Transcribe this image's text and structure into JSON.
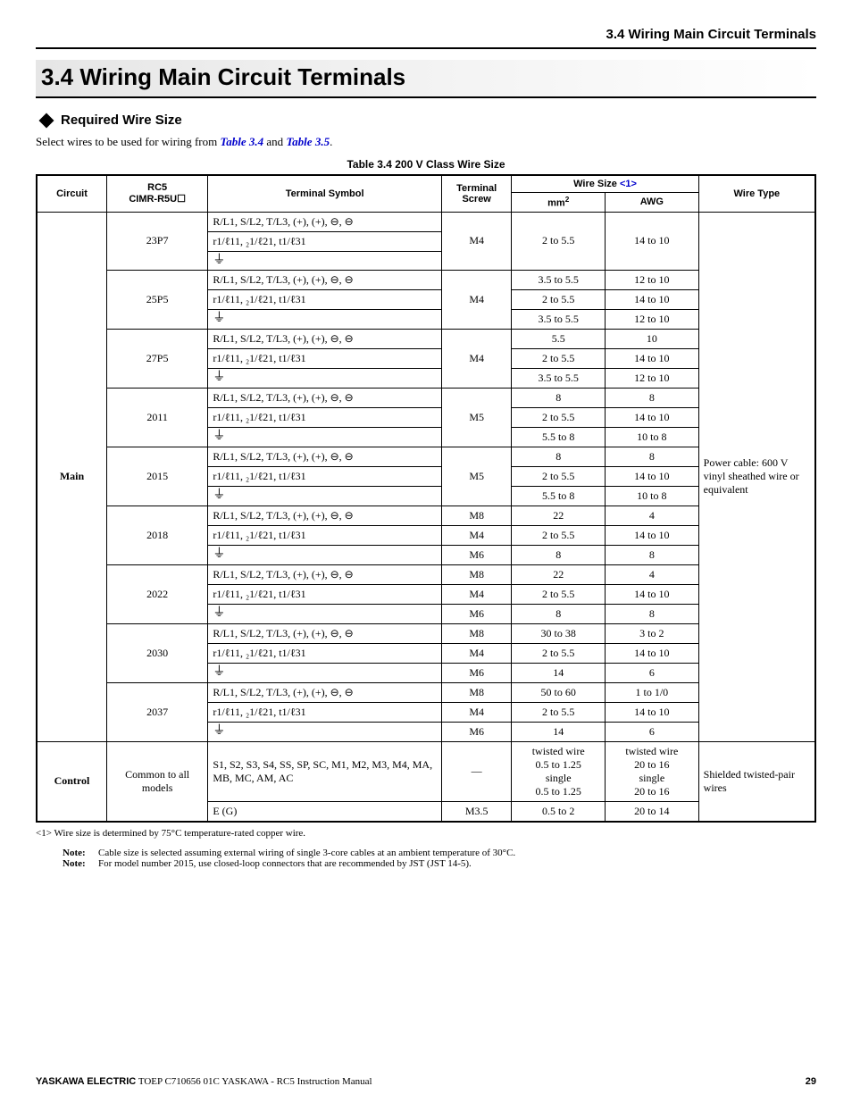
{
  "header_section": "3.4  Wiring Main Circuit Terminals",
  "h1": "3.4    Wiring Main Circuit Terminals",
  "subhead": "Required Wire Size",
  "intro_pre": "Select wires to be used for wiring from ",
  "intro_link1": "Table 3.4",
  "intro_mid": " and ",
  "intro_link2": "Table 3.5",
  "intro_post": ".",
  "table_caption": "Table 3.4  200 V Class Wire Size",
  "headers": {
    "circuit": "Circuit",
    "rc5": "RC5",
    "rc5_sub": "CIMR-R5U☐",
    "terminal_symbol": "Terminal Symbol",
    "terminal_screw": "Terminal Screw",
    "wire_size": "Wire Size ",
    "wire_size_ref": "<1>",
    "mm2": "mm",
    "mm2_sup": "2",
    "awg": "AWG",
    "wire_type": "Wire Type"
  },
  "circuit_main": "Main",
  "circuit_control": "Control",
  "wiretype_main": "Power cable: 600 V vinyl sheathed wire or equivalent",
  "wiretype_control": "Shielded twisted-pair wires",
  "sym_main": "R/L1, S/L2, T/L3, (+), (+), ⊖, ⊖",
  "sym_sub": "r1/ℓ11, ₂1/ℓ21, t1/ℓ31",
  "sym_ground": "⏚",
  "sym_control1": "S1, S2, S3, S4, SS, SP, SC, M1, M2, M3, M4, MA, MB, MC, AM, AC",
  "sym_control2": "E (G)",
  "control_model": "Common to all models",
  "dash": "—",
  "models": {
    "m1": "23P7",
    "m2": "25P5",
    "m3": "27P5",
    "m4": "2011",
    "m5": "2015",
    "m6": "2018",
    "m7": "2022",
    "m8": "2030",
    "m9": "2037"
  },
  "rows": {
    "r1_screw": "M4",
    "r1_mm": "2 to 5.5",
    "r1_awg": "14 to 10",
    "r2a_mm": "3.5 to 5.5",
    "r2a_awg": "12 to 10",
    "r2_screw": "M4",
    "r2b_mm": "2 to 5.5",
    "r2b_awg": "14 to 10",
    "r2c_mm": "3.5 to 5.5",
    "r2c_awg": "12 to 10",
    "r3a_mm": "5.5",
    "r3a_awg": "10",
    "r3_screw": "M4",
    "r3b_mm": "2 to 5.5",
    "r3b_awg": "14 to 10",
    "r3c_mm": "3.5 to 5.5",
    "r3c_awg": "12 to 10",
    "r4a_mm": "8",
    "r4a_awg": "8",
    "r4_screw": "M5",
    "r4b_mm": "2 to 5.5",
    "r4b_awg": "14 to 10",
    "r4c_mm": "5.5 to 8",
    "r4c_awg": "10 to 8",
    "r5a_mm": "8",
    "r5a_awg": "8",
    "r5_screw": "M5",
    "r5b_mm": "2 to 5.5",
    "r5b_awg": "14 to 10",
    "r5c_mm": "5.5 to 8",
    "r5c_awg": "10 to 8",
    "r6a_screw": "M8",
    "r6a_mm": "22",
    "r6a_awg": "4",
    "r6b_screw": "M4",
    "r6b_mm": "2 to 5.5",
    "r6b_awg": "14 to 10",
    "r6c_screw": "M6",
    "r6c_mm": "8",
    "r6c_awg": "8",
    "r7a_screw": "M8",
    "r7a_mm": "22",
    "r7a_awg": "4",
    "r7b_screw": "M4",
    "r7b_mm": "2 to 5.5",
    "r7b_awg": "14 to 10",
    "r7c_screw": "M6",
    "r7c_mm": "8",
    "r7c_awg": "8",
    "r8a_screw": "M8",
    "r8a_mm": "30 to 38",
    "r8a_awg": "3 to 2",
    "r8b_screw": "M4",
    "r8b_mm": "2 to 5.5",
    "r8b_awg": "14 to 10",
    "r8c_screw": "M6",
    "r8c_mm": "14",
    "r8c_awg": "6",
    "r9a_screw": "M8",
    "r9a_mm": "50 to 60",
    "r9a_awg": "1 to 1/0",
    "r9b_screw": "M4",
    "r9b_mm": "2 to 5.5",
    "r9b_awg": "14 to 10",
    "r9c_screw": "M6",
    "r9c_mm": "14",
    "r9c_awg": "6",
    "ctl_mm": "twisted wire\n0.5 to 1.25\nsingle\n0.5 to 1.25",
    "ctl_awg": "twisted wire\n20 to 16\nsingle\n20 to 16",
    "ctl2_screw": "M3.5",
    "ctl2_mm": "0.5 to 2",
    "ctl2_awg": "20 to 14"
  },
  "footnote": "<1> Wire size is determined by 75°C temperature-rated copper wire.",
  "note1_lbl": "Note:",
  "note1": "Cable size is selected assuming external wiring of single 3-core cables at an ambient temperature of 30°C.",
  "note2_lbl": "Note:",
  "note2": "For model number 2015, use closed-loop connectors that are recommended by JST (JST 14-5).",
  "footer_brand": "YASKAWA ELECTRIC",
  "footer_doc": " TOEP C710656 01C YASKAWA - RC5 Instruction Manual",
  "page_no": "29"
}
